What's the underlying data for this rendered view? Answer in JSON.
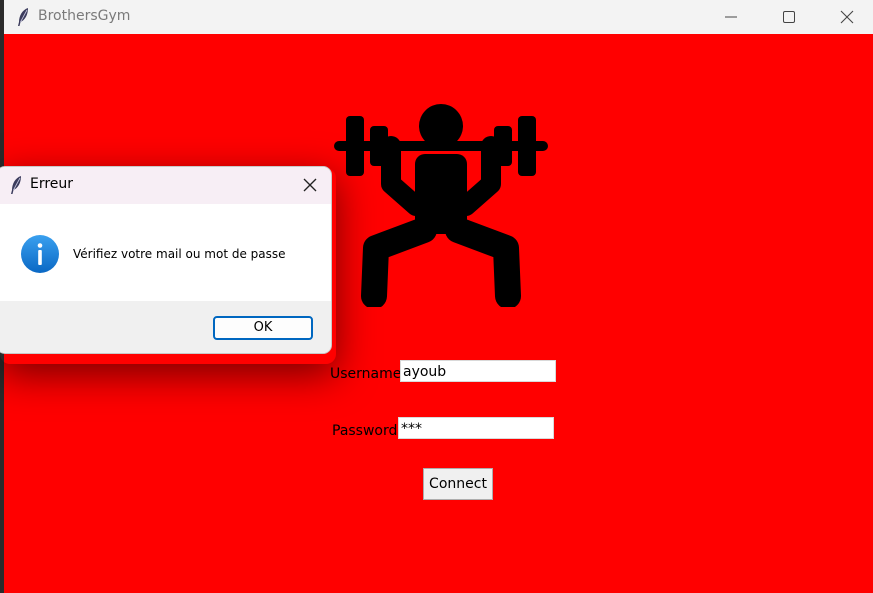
{
  "window": {
    "title": "BrothersGym",
    "app_icon": "feather-icon",
    "controls": [
      "minimize-icon",
      "maximize-icon",
      "close-icon"
    ]
  },
  "login": {
    "logo_icon": "weightlifter-icon",
    "username_label": "Username",
    "username_value": "ayoub",
    "password_label": "Password",
    "password_value": "***",
    "connect_label": "Connect",
    "background_color": "#ff0000"
  },
  "dialog": {
    "title": "Erreur",
    "icon": "info-icon",
    "message": "Vérifiez votre mail ou mot de passe",
    "ok_label": "OK",
    "accent_color": "#0067c0"
  }
}
